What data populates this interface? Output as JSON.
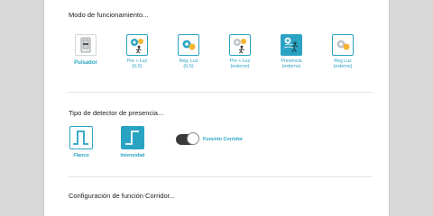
{
  "sections": {
    "modo_title": "Modo de funcionamiento...",
    "detector_title": "Tipo de detector de presencia...",
    "corridor_title": "Configuración de función Corridor..."
  },
  "modes": [
    {
      "label": "Pulsador",
      "icon": "push-button-icon",
      "selected": false
    },
    {
      "label": "Pre + Luz\n(ILS)",
      "icon": "presence-light-ils-icon",
      "selected": false
    },
    {
      "label": "Reg. Luz\n(ILS)",
      "icon": "light-regulation-ils-icon",
      "selected": false
    },
    {
      "label": "Pre + Luz\n(externo)",
      "icon": "presence-light-external-icon",
      "selected": false
    },
    {
      "label": "Presencia\n(externo)",
      "icon": "presence-external-icon",
      "selected": true
    },
    {
      "label": "Reg Luz\n(externo)",
      "icon": "light-regulation-external-icon",
      "selected": false
    }
  ],
  "detector_types": [
    {
      "label": "Flanco",
      "icon": "pulse-edge-icon",
      "selected": false
    },
    {
      "label": "Intensidad",
      "icon": "step-intensity-icon",
      "selected": true
    }
  ],
  "corridor_toggle": {
    "label": "Función Corridor",
    "on": true
  },
  "colors": {
    "accent": "#2aa3c3",
    "background": "#d9d9d9",
    "panel": "#ffffff"
  }
}
